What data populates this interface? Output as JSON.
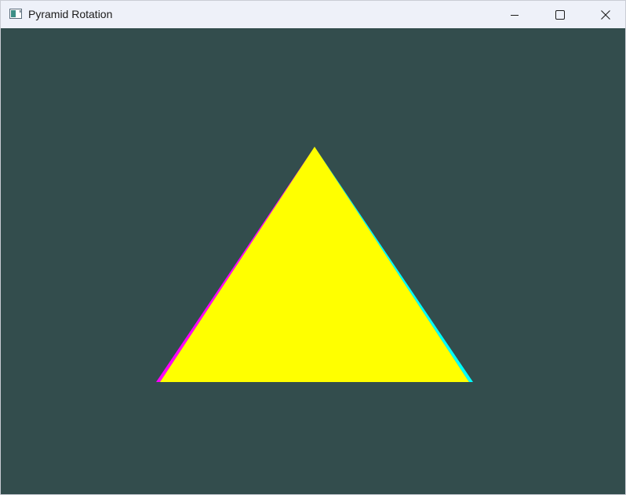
{
  "window": {
    "title": "Pyramid Rotation",
    "icon": "app-window-icon",
    "controls": [
      {
        "name": "minimize",
        "icon": "minimize-icon"
      },
      {
        "name": "maximize",
        "icon": "maximize-icon"
      },
      {
        "name": "close",
        "icon": "close-icon"
      }
    ]
  },
  "scene": {
    "background_color": "#334d4d",
    "faces": [
      {
        "name": "left-face",
        "color": "#ff00ff"
      },
      {
        "name": "right-face",
        "color": "#00ffff"
      },
      {
        "name": "front-face",
        "color": "#ffff00"
      }
    ]
  }
}
